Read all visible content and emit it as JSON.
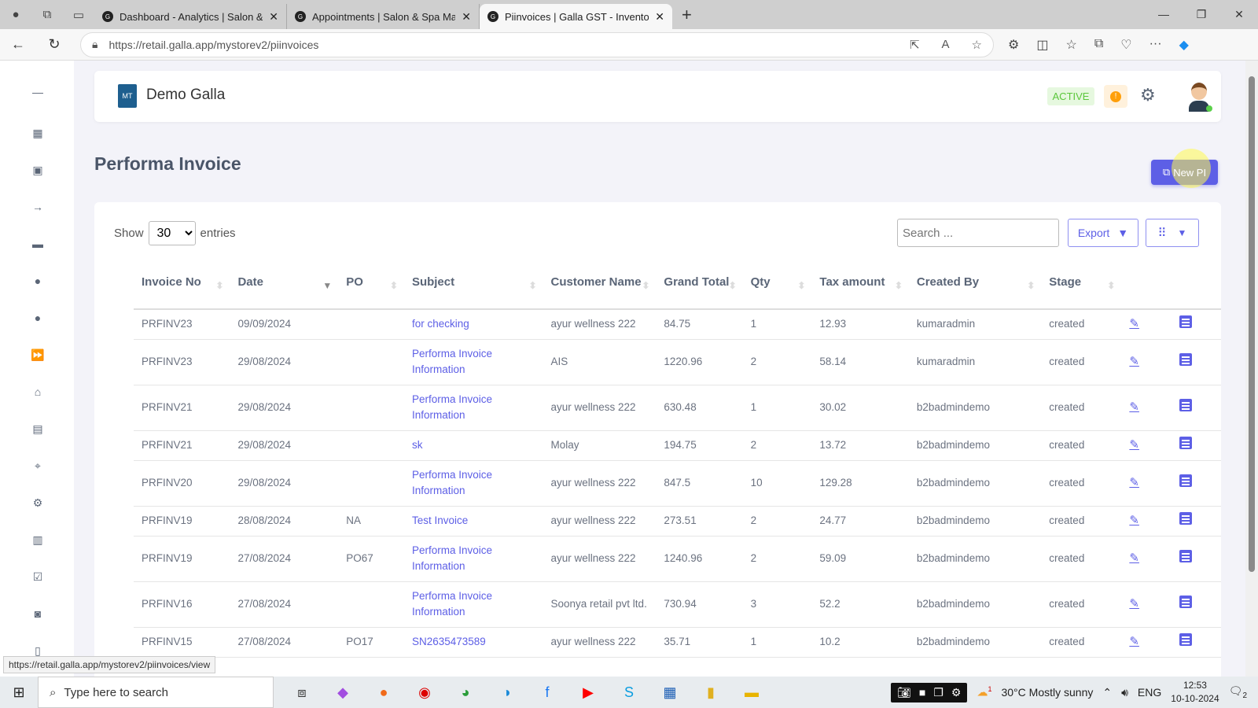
{
  "browser": {
    "tabs": [
      {
        "title": "Dashboard - Analytics | Salon & S",
        "active": false
      },
      {
        "title": "Appointments | Salon & Spa Man",
        "active": false
      },
      {
        "title": "Piinvoices | Galla GST - Inventory",
        "active": true
      }
    ],
    "url": "https://retail.galla.app/mystorev2/piinvoices",
    "status_url": "https://retail.galla.app/mystorev2/piinvoices/view"
  },
  "header": {
    "brand": "Demo Galla",
    "logo_text": "MT",
    "status": "ACTIVE",
    "alert": "!"
  },
  "page": {
    "title": "Performa Invoice",
    "new_button": "New PI"
  },
  "controls": {
    "show": "Show",
    "entries_value": "30",
    "entries": "entries",
    "search_placeholder": "Search ...",
    "export": "Export"
  },
  "table": {
    "columns": [
      "Invoice No",
      "Date",
      "PO",
      "Subject",
      "Customer Name",
      "Grand Total",
      "Qty",
      "Tax amount",
      "Created By",
      "Stage"
    ],
    "rows": [
      [
        "PRFINV23",
        "09/09/2024",
        "",
        "for checking",
        "ayur wellness 222",
        "84.75",
        "1",
        "12.93",
        "kumaradmin",
        "created"
      ],
      [
        "PRFINV23",
        "29/08/2024",
        "",
        "Performa Invoice Information",
        "AIS",
        "1220.96",
        "2",
        "58.14",
        "kumaradmin",
        "created"
      ],
      [
        "PRFINV21",
        "29/08/2024",
        "",
        "Performa Invoice Information",
        "ayur wellness 222",
        "630.48",
        "1",
        "30.02",
        "b2badmindemo",
        "created"
      ],
      [
        "PRFINV21",
        "29/08/2024",
        "",
        "sk",
        "Molay",
        "194.75",
        "2",
        "13.72",
        "b2badmindemo",
        "created"
      ],
      [
        "PRFINV20",
        "29/08/2024",
        "",
        "Performa Invoice Information",
        "ayur wellness 222",
        "847.5",
        "10",
        "129.28",
        "b2badmindemo",
        "created"
      ],
      [
        "PRFINV19",
        "28/08/2024",
        "NA",
        "Test Invoice",
        "ayur wellness 222",
        "273.51",
        "2",
        "24.77",
        "b2badmindemo",
        "created"
      ],
      [
        "PRFINV19",
        "27/08/2024",
        "PO67",
        "Performa Invoice Information",
        "ayur wellness 222",
        "1240.96",
        "2",
        "59.09",
        "b2badmindemo",
        "created"
      ],
      [
        "PRFINV16",
        "27/08/2024",
        "",
        "Performa Invoice Information",
        "Soonya retail pvt ltd.",
        "730.94",
        "3",
        "52.2",
        "b2badmindemo",
        "created"
      ],
      [
        "PRFINV15",
        "27/08/2024",
        "PO17",
        "SN2635473589",
        "ayur wellness 222",
        "35.71",
        "1",
        "10.2",
        "b2badmindemo",
        "created"
      ]
    ]
  },
  "taskbar": {
    "search_placeholder": "Type here to search",
    "weather": "30°C  Mostly sunny",
    "lang": "ENG",
    "time": "12:53",
    "date": "10-10-2024",
    "notifications": "2",
    "weather_badge": "1"
  },
  "colors": {
    "accent": "#5d5fe6",
    "active_green": "#5bc73c",
    "warning": "#ff9f0a"
  }
}
